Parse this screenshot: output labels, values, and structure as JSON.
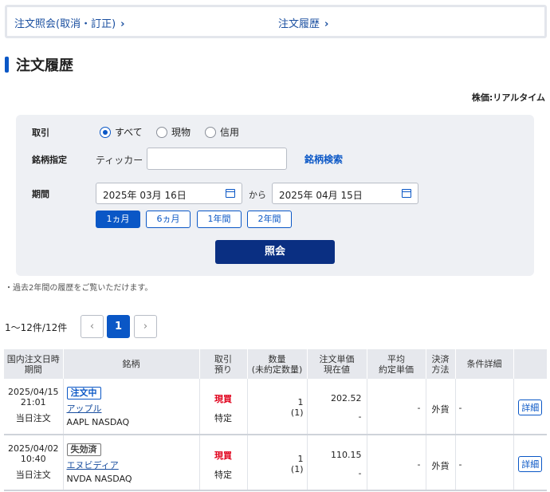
{
  "top_nav": {
    "order_inquiry": "注文照会(取消・訂正)",
    "order_history": "注文履歴",
    "chevron": "›"
  },
  "page_title": "注文履歴",
  "price_mode": "株価:リアルタイム",
  "filter": {
    "trade_label": "取引",
    "trade_options": [
      "すべて",
      "現物",
      "信用"
    ],
    "trade_selected": "すべて",
    "stock_label": "銘柄指定",
    "ticker_label": "ティッカー",
    "ticker_value": "",
    "stock_search": "銘柄検索",
    "period_label": "期間",
    "date_from": "2025年 03月 16日",
    "from_word": "から",
    "date_to": "2025年 04月 15日",
    "periods": [
      "1ヵ月",
      "6ヵ月",
      "1年間",
      "2年間"
    ],
    "period_selected": "1ヵ月",
    "submit": "照会"
  },
  "note": "・過去2年間の履歴をご覧いただけます。",
  "pagination": {
    "count_text": "1〜12件/12件",
    "prev": "‹",
    "current": "1",
    "next": "›"
  },
  "table": {
    "headers": {
      "date": [
        "国内注文日時",
        "期間"
      ],
      "name": "銘柄",
      "trade": [
        "取引",
        "預り"
      ],
      "qty": [
        "数量",
        "(未約定数量)"
      ],
      "price": [
        "注文単価",
        "現在値"
      ],
      "avg": [
        "平均",
        "約定単価"
      ],
      "method": [
        "決済",
        "方法"
      ],
      "cond": "条件詳細"
    },
    "rows": [
      {
        "date": "2025/04/15",
        "time": "21:01",
        "period": "当日注文",
        "status": "注文中",
        "status_type": "active",
        "name": "アップル",
        "ticker": "AAPL NASDAQ",
        "trade": "現買",
        "account": "特定",
        "qty": "1",
        "unfilled": "(1)",
        "order_price": "202.52",
        "current_price": "-",
        "avg_price": "-",
        "method": "外貨",
        "condition": "-",
        "detail": "詳細"
      },
      {
        "date": "2025/04/02",
        "time": "10:40",
        "period": "当日注文",
        "status": "失効済",
        "status_type": "expired",
        "name": "エヌビディア",
        "ticker": "NVDA NASDAQ",
        "trade": "現買",
        "account": "特定",
        "qty": "1",
        "unfilled": "(1)",
        "order_price": "110.15",
        "current_price": "-",
        "avg_price": "-",
        "method": "外貨",
        "condition": "-",
        "detail": "詳細"
      }
    ]
  },
  "colors": {
    "accent": "#0a57c6",
    "submit_bg": "#0a2f82",
    "buy_red": "#e0001b",
    "panel_bg": "#eef0f4"
  }
}
